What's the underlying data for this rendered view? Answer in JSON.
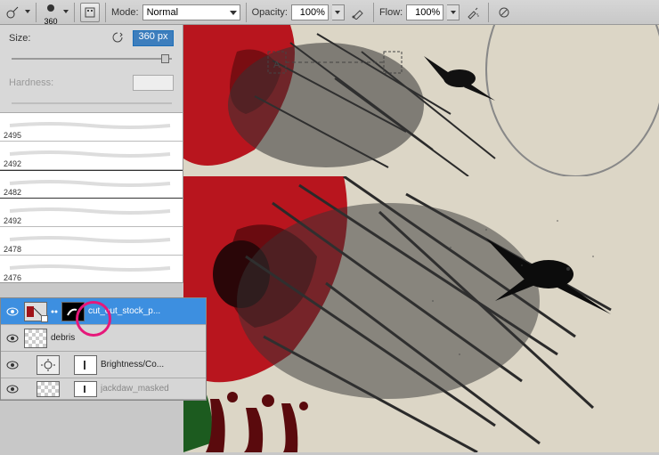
{
  "toolbar": {
    "brush_size_small": "360",
    "mode_label": "Mode:",
    "mode_value": "Normal",
    "opacity_label": "Opacity:",
    "opacity_value": "100%",
    "flow_label": "Flow:",
    "flow_value": "100%"
  },
  "brush_panel": {
    "size_label": "Size:",
    "size_value": "360 px",
    "hardness_label": "Hardness:",
    "brushes": [
      {
        "id": "2495"
      },
      {
        "id": "2492"
      },
      {
        "id": "2482"
      },
      {
        "id": "2492"
      },
      {
        "id": "2478"
      },
      {
        "id": "2476"
      }
    ]
  },
  "layers": [
    {
      "name": "cut_out_stock_p...",
      "selected": true,
      "has_mask": true,
      "mask_black": true,
      "thumb": "art"
    },
    {
      "name": "debris",
      "has_mask": false,
      "thumb": "checker"
    },
    {
      "name": "Brightness/Co...",
      "adjustment": true,
      "has_mask": true
    },
    {
      "name": "jackdaw_masked",
      "has_mask": true,
      "thumb": "checker"
    }
  ]
}
